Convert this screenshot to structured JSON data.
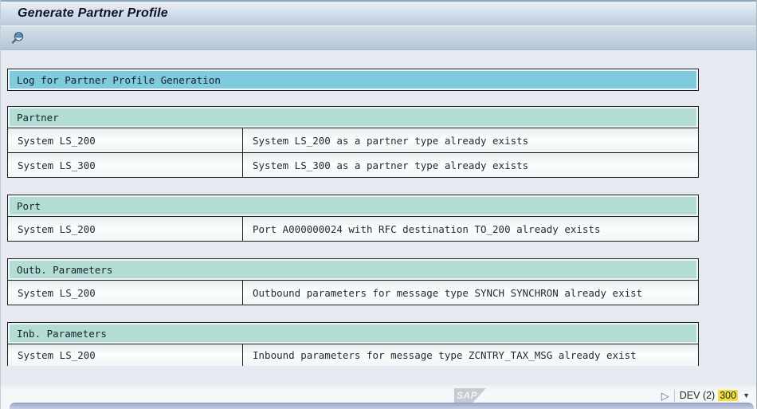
{
  "window": {
    "title": "Generate Partner Profile"
  },
  "log": {
    "title": "Log for Partner Profile Generation",
    "sections": [
      {
        "title": "Partner",
        "clipped": false,
        "rows": [
          {
            "system": "System LS_200",
            "message": "System LS_200 as a partner type already exists"
          },
          {
            "system": "System LS_300",
            "message": "System LS_300 as a partner type already exists"
          }
        ]
      },
      {
        "title": "Port",
        "clipped": false,
        "rows": [
          {
            "system": "System LS_200",
            "message": "Port A000000024 with RFC destination TO_200 already exists"
          }
        ]
      },
      {
        "title": "Outb. Parameters",
        "clipped": false,
        "rows": [
          {
            "system": "System LS_200",
            "message": "Outbound parameters for message type SYNCH SYNCHRON already exist"
          }
        ]
      },
      {
        "title": "Inb. Parameters",
        "clipped": true,
        "rows": [
          {
            "system": "System LS_200",
            "message": "Inbound parameters for message type ZCNTRY_TAX_MSG already exist"
          }
        ]
      }
    ]
  },
  "statusbar": {
    "sap_logo": "SAP",
    "system": "DEV (2)",
    "client": "300",
    "expand_icon": "▷",
    "menu_icon": "▼"
  },
  "colors": {
    "log_header_bg": "#7fcadd",
    "section_header_bg": "#b2dcd4",
    "client_highlight": "#f2df3b",
    "table_border": "#1c1f22"
  }
}
